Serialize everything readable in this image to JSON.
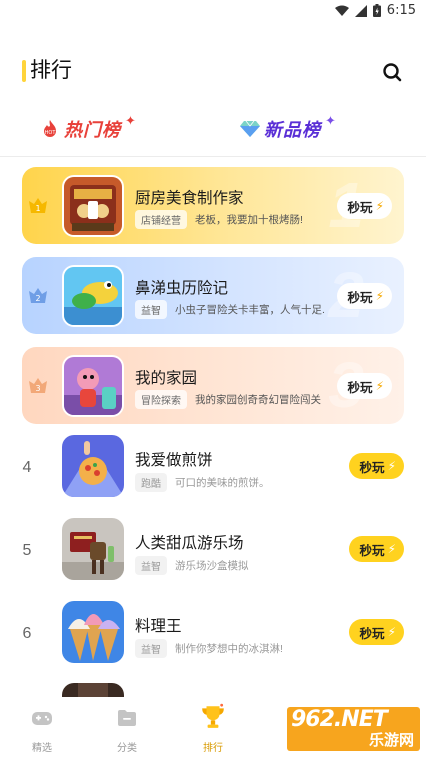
{
  "status_bar": {
    "time": "6:15"
  },
  "header": {
    "title": "排行"
  },
  "tabs": [
    {
      "label": "热门榜",
      "active": true
    },
    {
      "label": "新品榜",
      "active": false
    }
  ],
  "play_label": "秒玩",
  "ranking": [
    {
      "rank": "1",
      "name": "厨房美食制作家",
      "tag": "店铺经营",
      "desc": "老板，我要加十根烤肠!"
    },
    {
      "rank": "2",
      "name": "鼻涕虫历险记",
      "tag": "益智",
      "desc": "小虫子冒险关卡丰富，人气十足."
    },
    {
      "rank": "3",
      "name": "我的家园",
      "tag": "冒险探索",
      "desc": "我的家园创奇奇幻冒险闯关"
    },
    {
      "rank": "4",
      "name": "我爱做煎饼",
      "tag": "跑酷",
      "desc": "可口的美味的煎饼。"
    },
    {
      "rank": "5",
      "name": "人类甜瓜游乐场",
      "tag": "益智",
      "desc": "游乐场沙盒模拟"
    },
    {
      "rank": "6",
      "name": "料理王",
      "tag": "益智",
      "desc": "制作你梦想中的冰淇淋!"
    }
  ],
  "bottom_nav": [
    {
      "label": "精选",
      "icon": "gamepad-icon",
      "active": false
    },
    {
      "label": "分类",
      "icon": "folder-icon",
      "active": false
    },
    {
      "label": "排行",
      "icon": "trophy-icon",
      "active": true
    }
  ],
  "watermark": {
    "top": "962.NET",
    "bottom": "乐游网"
  },
  "colors": {
    "accent": "#ffd21f",
    "hot": "#e8413a",
    "new": "#5a2fd6"
  }
}
